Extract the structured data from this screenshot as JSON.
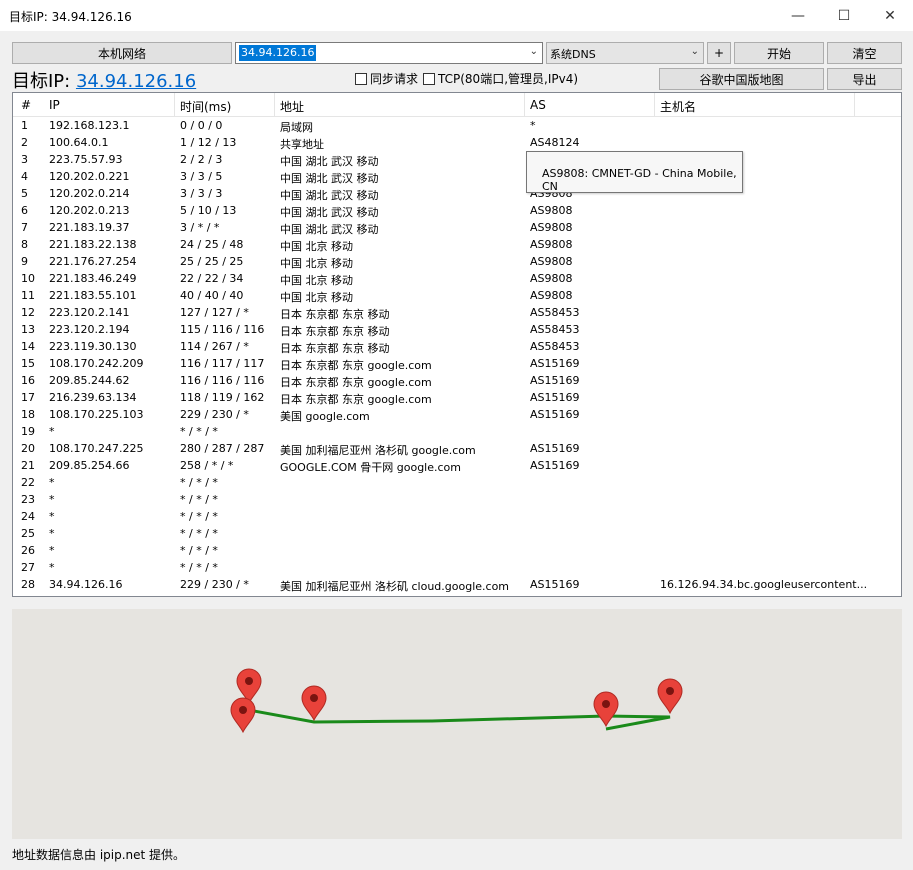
{
  "window": {
    "title": "目标IP: 34.94.126.16",
    "minimize": "—",
    "maximize": "☐",
    "close": "✕"
  },
  "toolbar": {
    "local_network": "本机网络",
    "ip_input": "34.94.126.16",
    "dns_select": "系统DNS",
    "plus": "+",
    "start": "开始",
    "clear": "清空",
    "google_map": "谷歌中国版地图",
    "export": "导出",
    "sync_request": "同步请求",
    "tcp_option": "TCP(80端口,管理员,IPv4)"
  },
  "target": {
    "label": "目标IP: ",
    "ip": "34.94.126.16"
  },
  "table": {
    "columns": [
      "#",
      "IP",
      "时间(ms)",
      "地址",
      "AS",
      "主机名"
    ],
    "rows": [
      [
        "1",
        "192.168.123.1",
        "0 / 0 / 0",
        "局域网",
        "*",
        ""
      ],
      [
        "2",
        "100.64.0.1",
        "1 / 12 / 13",
        "共享地址",
        "AS48124",
        ""
      ],
      [
        "3",
        "223.75.57.93",
        "2 / 2 / 3",
        "中国 湖北 武汉 移动",
        "",
        ""
      ],
      [
        "4",
        "120.202.0.221",
        "3 / 3 / 5",
        "中国 湖北 武汉 移动",
        "",
        ""
      ],
      [
        "5",
        "120.202.0.214",
        "3 / 3 / 3",
        "中国 湖北 武汉 移动",
        "AS9808",
        ""
      ],
      [
        "6",
        "120.202.0.213",
        "5 / 10 / 13",
        "中国 湖北 武汉 移动",
        "AS9808",
        ""
      ],
      [
        "7",
        "221.183.19.37",
        "3 / * / *",
        "中国 湖北 武汉 移动",
        "AS9808",
        ""
      ],
      [
        "8",
        "221.183.22.138",
        "24 / 25 / 48",
        "中国 北京 移动",
        "AS9808",
        ""
      ],
      [
        "9",
        "221.176.27.254",
        "25 / 25 / 25",
        "中国 北京 移动",
        "AS9808",
        ""
      ],
      [
        "10",
        "221.183.46.249",
        "22 / 22 / 34",
        "中国 北京 移动",
        "AS9808",
        ""
      ],
      [
        "11",
        "221.183.55.101",
        "40 / 40 / 40",
        "中国 北京 移动",
        "AS9808",
        ""
      ],
      [
        "12",
        "223.120.2.141",
        "127 / 127 / *",
        "日本 东京都 东京 移动",
        "AS58453",
        ""
      ],
      [
        "13",
        "223.120.2.194",
        "115 / 116 / 116",
        "日本 东京都 东京 移动",
        "AS58453",
        ""
      ],
      [
        "14",
        "223.119.30.130",
        "114 / 267 / *",
        "日本 东京都 东京 移动",
        "AS58453",
        ""
      ],
      [
        "15",
        "108.170.242.209",
        "116 / 117 / 117",
        "日本 东京都 东京 google.com",
        "AS15169",
        ""
      ],
      [
        "16",
        "209.85.244.62",
        "116 / 116 / 116",
        "日本 东京都 东京 google.com",
        "AS15169",
        ""
      ],
      [
        "17",
        "216.239.63.134",
        "118 / 119 / 162",
        "日本 东京都 东京 google.com",
        "AS15169",
        ""
      ],
      [
        "18",
        "108.170.225.103",
        "229 / 230 / *",
        "美国 google.com",
        "AS15169",
        ""
      ],
      [
        "19",
        "*",
        "* / * / *",
        "",
        "",
        ""
      ],
      [
        "20",
        "108.170.247.225",
        "280 / 287 / 287",
        "美国 加利福尼亚州 洛杉矶 google.com",
        "AS15169",
        ""
      ],
      [
        "21",
        "209.85.254.66",
        "258 / * / *",
        "GOOGLE.COM 骨干网 google.com",
        "AS15169",
        ""
      ],
      [
        "22",
        "*",
        "* / * / *",
        "",
        "",
        ""
      ],
      [
        "23",
        "*",
        "* / * / *",
        "",
        "",
        ""
      ],
      [
        "24",
        "*",
        "* / * / *",
        "",
        "",
        ""
      ],
      [
        "25",
        "*",
        "* / * / *",
        "",
        "",
        ""
      ],
      [
        "26",
        "*",
        "* / * / *",
        "",
        "",
        ""
      ],
      [
        "27",
        "*",
        "* / * / *",
        "",
        "",
        ""
      ],
      [
        "28",
        "34.94.126.16",
        "229 / 230 / *",
        "美国 加利福尼亚州 洛杉矶 cloud.google.com",
        "AS15169",
        "16.126.94.34.bc.googleusercontent..."
      ]
    ]
  },
  "tooltip": {
    "text": "AS9808: CMNET-GD - China Mobile, CN"
  },
  "map": {
    "route_color": "#1a8a1a",
    "pin_color": "#e8423a"
  },
  "status": {
    "text": "地址数据信息由 ipip.net 提供。"
  }
}
